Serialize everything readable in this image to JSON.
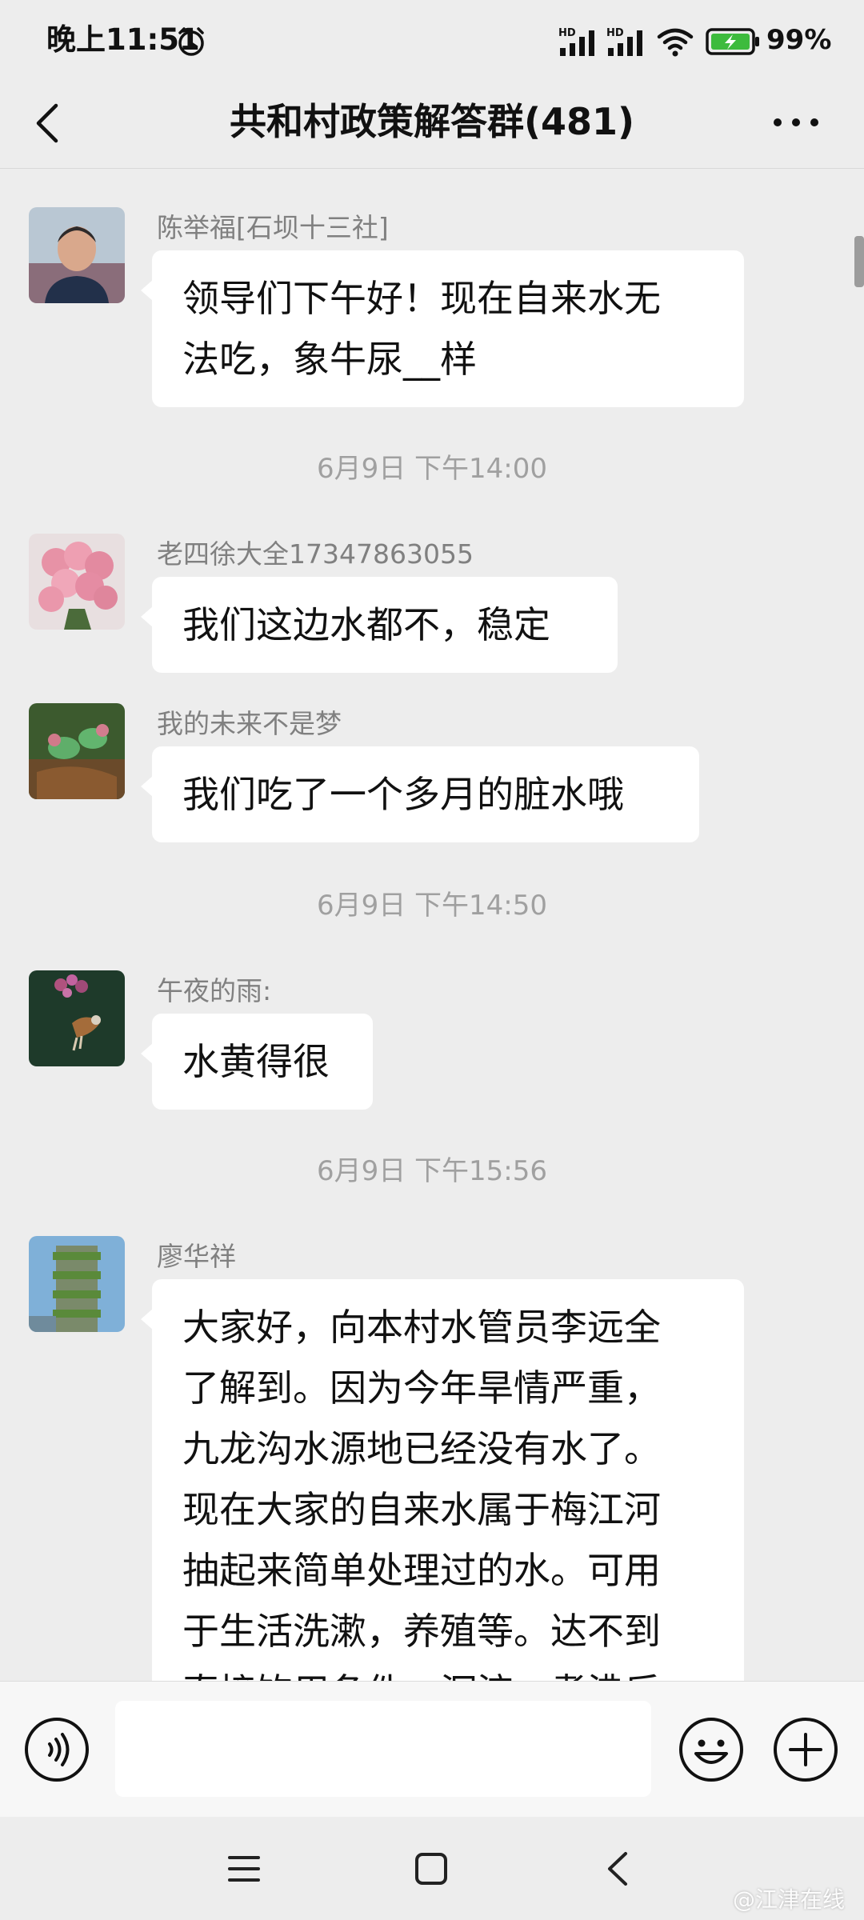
{
  "status_bar": {
    "time": "晚上11:51",
    "signal_1_label": "HD",
    "signal_2_label": "HD",
    "battery": "99%"
  },
  "header": {
    "title": "共和村政策解答群(481)"
  },
  "messages": [
    {
      "sender": "陈举福[石坝十三社]",
      "lines": [
        "领导们下午好！现在自来水无",
        "法吃，象牛尿__样"
      ]
    },
    {
      "timestamp": "6月9日 下午14:00"
    },
    {
      "sender": "老四徐大全17347863055",
      "lines": [
        "我们这边水都不，稳定"
      ]
    },
    {
      "sender": "我的未来不是梦",
      "lines": [
        "我们吃了一个多月的脏水哦"
      ]
    },
    {
      "timestamp": "6月9日 下午14:50"
    },
    {
      "sender": "午夜的雨:",
      "lines": [
        "水黄得很"
      ]
    },
    {
      "timestamp": "6月9日 下午15:56"
    },
    {
      "sender": "廖华祥",
      "lines": [
        "大家好，向本村水管员李远全",
        "了解到。因为今年旱情严重，",
        "九龙沟水源地已经没有水了。",
        "现在大家的自来水属于梅江河",
        "抽起来简单处理过的水。可用",
        "于生活洗漱，养殖等。达不到",
        "直接饮用条件，沉淀，煮沸后"
      ]
    }
  ],
  "input": {
    "placeholder": ""
  },
  "watermark": "@江津在线",
  "icons": {
    "alarm": "alarm-clock-icon",
    "back": "chevron-left-icon",
    "more": "more-dots-icon",
    "voice": "voice-icon",
    "emoji": "emoji-icon",
    "plus": "plus-icon",
    "nav_menu": "menu-icon",
    "nav_home": "home-square-icon",
    "nav_back": "nav-back-icon"
  },
  "colors": {
    "background": "#ededed",
    "bubble": "#ffffff",
    "battery_fill": "#3dbb3d"
  }
}
